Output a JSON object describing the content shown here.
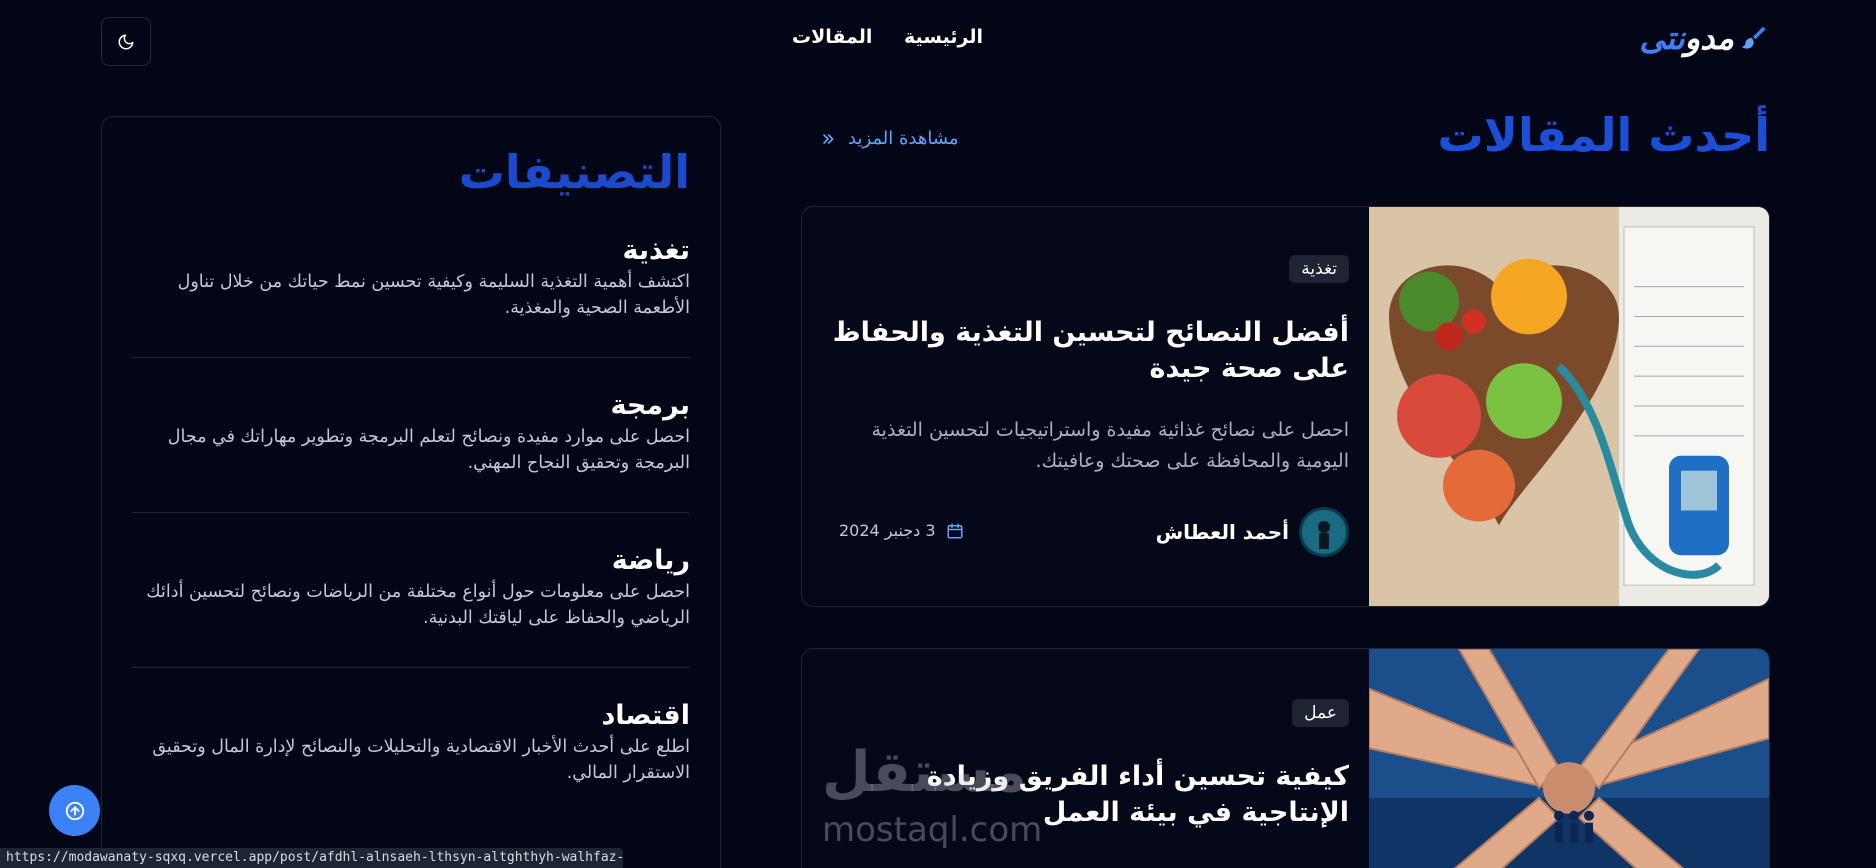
{
  "header": {
    "logo_text_main": "مدو",
    "logo_text_accent": "نتى",
    "nav": {
      "home": "الرئيسية",
      "articles": "المقالات"
    }
  },
  "categories": {
    "title": "التصنيفات",
    "items": [
      {
        "name": "تغذية",
        "desc": "اكتشف أهمية التغذية السليمة وكيفية تحسين نمط حياتك من خلال تناول الأطعمة الصحية والمغذية."
      },
      {
        "name": "برمجة",
        "desc": "احصل على موارد مفيدة ونصائح لتعلم البرمجة وتطوير مهاراتك في مجال البرمجة وتحقيق النجاح المهني."
      },
      {
        "name": "رياضة",
        "desc": "احصل على معلومات حول أنواع مختلفة من الرياضات ونصائح لتحسين أدائك الرياضي والحفاظ على لياقتك البدنية."
      },
      {
        "name": "اقتصاد",
        "desc": "اطلع على أحدث الأخبار الاقتصادية والتحليلات والنصائح لإدارة المال وتحقيق الاستقرار المالي."
      }
    ]
  },
  "latest": {
    "title": "أحدث المقالات",
    "see_more": "مشاهدة المزيد",
    "posts": [
      {
        "tag": "تغذية",
        "title": "أفضل النصائح لتحسين التغذية والحفاظ على صحة جيدة",
        "excerpt": "احصل على نصائح غذائية مفيدة واستراتيجيات لتحسين التغذية اليومية والمحافظة على صحتك وعافيتك.",
        "author": "أحمد العطاش",
        "date": "3 دجنبر 2024"
      },
      {
        "tag": "عمل",
        "title": "كيفية تحسين أداء الفريق وزيادة الإنتاجية في بيئة العمل"
      }
    ]
  },
  "watermark": {
    "ar": "مستقل",
    "en": "mostaql.com"
  },
  "status_bar": "https://modawanaty-sqxq.vercel.app/post/afdhl-alnsaeh-lthsyn-altghthyh-walhfaz-ala-shh-j..."
}
